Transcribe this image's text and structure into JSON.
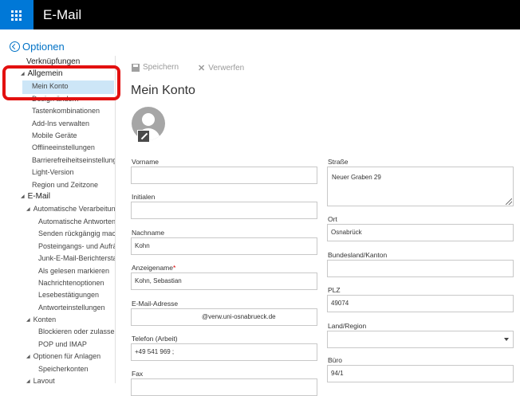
{
  "app": {
    "title": "E-Mail"
  },
  "back": {
    "label": "Optionen"
  },
  "nav": {
    "items": [
      {
        "label": "Verknüpfungen",
        "level": 0,
        "expander": false
      },
      {
        "label": "Allgemein",
        "level": 0,
        "expander": true
      },
      {
        "label": "Mein Konto",
        "level": 1,
        "selected": true
      },
      {
        "label": "Design ändern",
        "level": 1
      },
      {
        "label": "Tastenkombinationen",
        "level": 1
      },
      {
        "label": "Add-Ins verwalten",
        "level": 1
      },
      {
        "label": "Mobile Geräte",
        "level": 1
      },
      {
        "label": "Offlineeinstellungen",
        "level": 1
      },
      {
        "label": "Barrierefreiheitseinstellungen",
        "level": 1
      },
      {
        "label": "Light-Version",
        "level": 1
      },
      {
        "label": "Region und Zeitzone",
        "level": 1
      },
      {
        "label": "E-Mail",
        "level": 0,
        "expander": true
      },
      {
        "label": "Automatische Verarbeitung",
        "level": 1,
        "expander": true
      },
      {
        "label": "Automatische Antworten",
        "level": 2
      },
      {
        "label": "Senden rückgängig machen",
        "level": 2
      },
      {
        "label": "Posteingangs- und Aufräumregeln",
        "level": 2
      },
      {
        "label": "Junk-E-Mail-Berichterstattung",
        "level": 2
      },
      {
        "label": "Als gelesen markieren",
        "level": 2
      },
      {
        "label": "Nachrichtenoptionen",
        "level": 2
      },
      {
        "label": "Lesebestätigungen",
        "level": 2
      },
      {
        "label": "Antworteinstellungen",
        "level": 2
      },
      {
        "label": "Konten",
        "level": 1,
        "expander": true
      },
      {
        "label": "Blockieren oder zulassen",
        "level": 2
      },
      {
        "label": "POP und IMAP",
        "level": 2
      },
      {
        "label": "Optionen für Anlagen",
        "level": 1,
        "expander": true
      },
      {
        "label": "Speicherkonten",
        "level": 2
      },
      {
        "label": "Layout",
        "level": 1,
        "expander": true
      }
    ]
  },
  "toolbar": {
    "save_label": "Speichern",
    "discard_label": "Verwerfen"
  },
  "page": {
    "title": "Mein Konto"
  },
  "form": {
    "vorname": {
      "label": "Vorname",
      "value": ""
    },
    "initialen": {
      "label": "Initialen",
      "value": ""
    },
    "nachname": {
      "label": "Nachname",
      "value": "Kohn"
    },
    "anzeigename": {
      "label": "Anzeigename",
      "required_mark": "*",
      "value": "Kohn, Sebastian"
    },
    "email": {
      "label": "E-Mail-Adresse",
      "value": "@verw.uni-osnabrueck.de"
    },
    "telefon": {
      "label": "Telefon (Arbeit)",
      "value": "+49 541 969 ;"
    },
    "fax": {
      "label": "Fax",
      "value": ""
    },
    "strasse": {
      "label": "Straße",
      "value": "Neuer Graben 29"
    },
    "ort": {
      "label": "Ort",
      "value": "Osnabrück"
    },
    "bundesland": {
      "label": "Bundesland/Kanton",
      "value": ""
    },
    "plz": {
      "label": "PLZ",
      "value": "49074"
    },
    "land": {
      "label": "Land/Region",
      "value": ""
    },
    "buero": {
      "label": "Büro",
      "value": "94/1"
    }
  },
  "colors": {
    "accent": "#0078d7",
    "link": "#0072c6",
    "highlight": "#e3100f",
    "selection": "#cde6f7"
  }
}
